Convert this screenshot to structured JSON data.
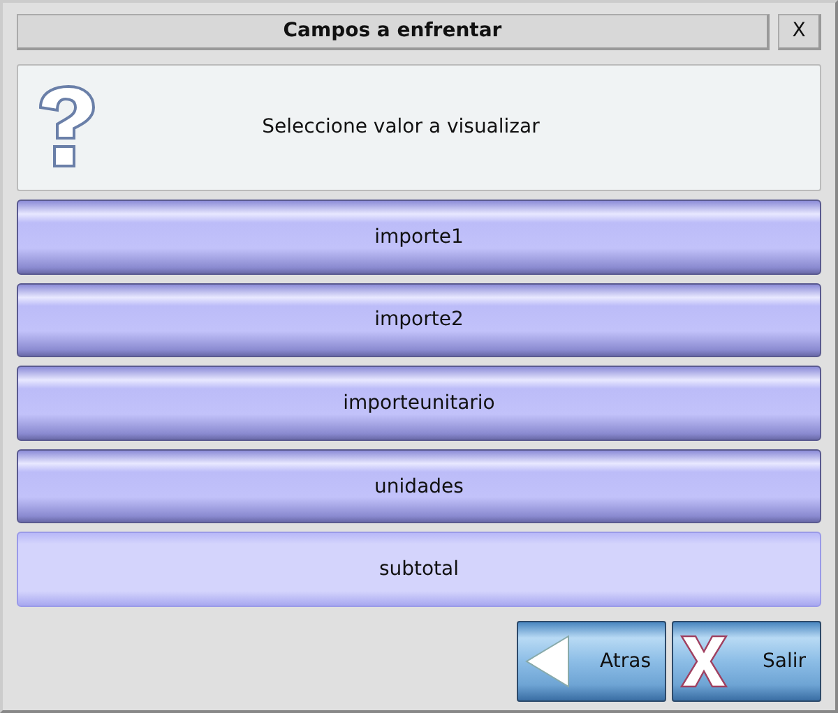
{
  "window": {
    "title": "Campos a enfrentar",
    "close": "X"
  },
  "message": "Seleccione valor a visualizar",
  "options": [
    {
      "label": "importe1",
      "selected": false
    },
    {
      "label": "importe2",
      "selected": false
    },
    {
      "label": "importeunitario",
      "selected": false
    },
    {
      "label": "unidades",
      "selected": false
    },
    {
      "label": "subtotal",
      "selected": true
    }
  ],
  "buttons": [
    {
      "kind": "back",
      "label": "Atras"
    },
    {
      "kind": "exit",
      "label": "Salir"
    }
  ]
}
